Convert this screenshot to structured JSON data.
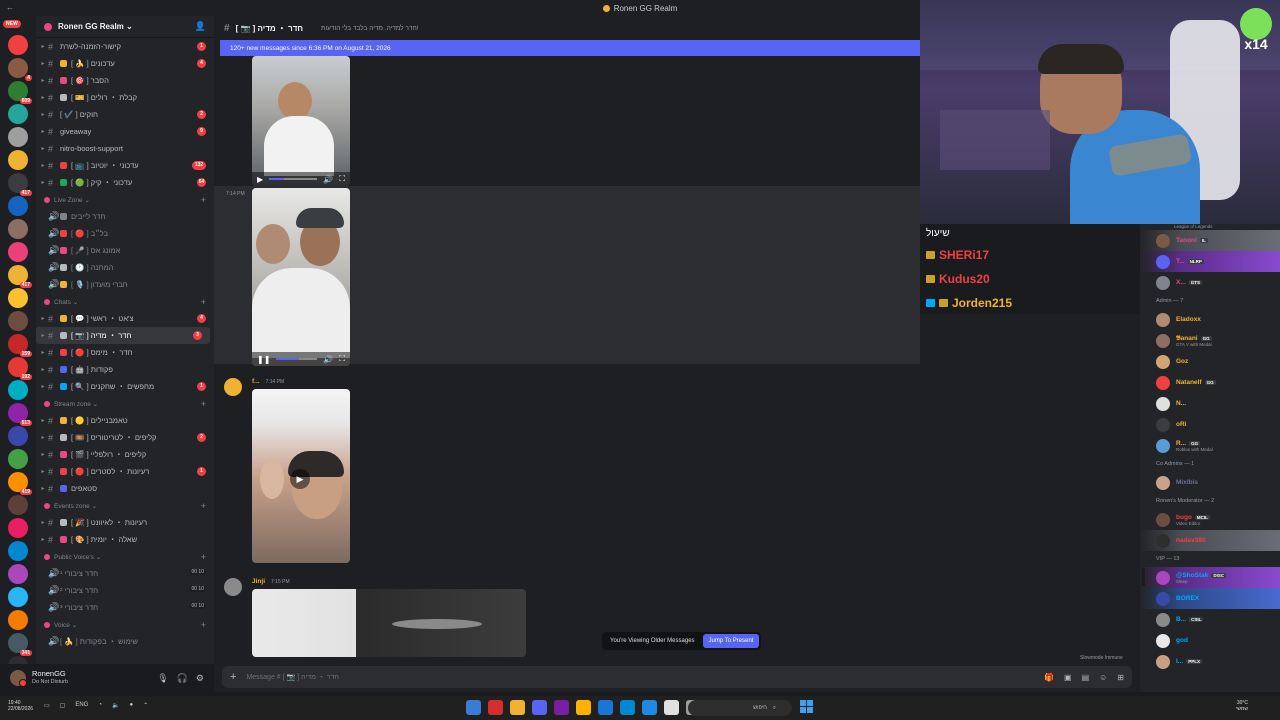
{
  "window": {
    "title": "Ronen GG Realm",
    "back_label": "←"
  },
  "rail": {
    "new_badge": "NEW",
    "guild_badges": [
      "",
      "4",
      "609",
      "",
      "",
      "",
      "417",
      "",
      "",
      "",
      "417",
      "",
      "",
      "159",
      "192",
      "",
      "513",
      "",
      "",
      "419",
      "",
      "",
      "",
      "",
      "",
      "",
      "341",
      "",
      "",
      ""
    ]
  },
  "server": {
    "name": "Ronen GG Realm ⌄"
  },
  "channels": [
    {
      "type": "text",
      "label": "קישור-הזמנה-לשרת",
      "count": "1",
      "emo": ""
    },
    {
      "type": "text",
      "label": "[ 🍌 ] עדכונים",
      "count": "4",
      "emo": "#f0b232"
    },
    {
      "type": "text",
      "label": "[ 🎯 ] הסבר",
      "count": "",
      "emo": "#e8497f"
    },
    {
      "type": "text",
      "label": "[ 🎫 ] קבלת ・ רולים",
      "count": "",
      "emo": "#b5bac1"
    },
    {
      "type": "text",
      "label": "[ ✔️ ] חוקים",
      "count": "2",
      "emo": ""
    },
    {
      "type": "text",
      "label": "giveaway",
      "count": "9",
      "emo": ""
    },
    {
      "type": "text",
      "label": "nitro-boost-support",
      "count": "",
      "emo": ""
    },
    {
      "type": "text",
      "label": "[ 📺 ] עדכוני ・ יוטיוב",
      "count": "132",
      "emo": "#f23f43"
    },
    {
      "type": "text",
      "label": "[ 🟢 ] עדכוני ・ קיק",
      "count": "64",
      "emo": "#23a55a"
    }
  ],
  "cat_live": {
    "label": "Live Zone ⌄",
    "plus": "+"
  },
  "live_channels": [
    {
      "label": "חדר לייבים",
      "emo": "#80848e"
    },
    {
      "label": "[ 🔴 ] בל״ב",
      "emo": "#f23f43"
    },
    {
      "label": "[ 🎤 ] אמונג אס",
      "emo": "#e8497f"
    },
    {
      "label": "[ 🕐 ] המתנה",
      "emo": "#b5bac1"
    },
    {
      "label": "[ 🎙️ ] חברי מועדון",
      "emo": "#f0b232"
    }
  ],
  "cat_chats": {
    "label": "Chats ⌄",
    "plus": "+"
  },
  "chat_channels": [
    {
      "label": "[ 💬 ] צ'אט ・ ראשי",
      "count": "4",
      "emo": "#f0b232",
      "active": false
    },
    {
      "label": "[ 📷 ] חדר ・ מדיה",
      "count": "3",
      "emo": "#b5bac1",
      "active": true
    },
    {
      "label": "[ 🔴 ] חדר ・ מימס",
      "count": "",
      "emo": "#f23f43",
      "active": false
    },
    {
      "label": "[ 🤖 ] פקודות",
      "count": "",
      "emo": "#5865f2",
      "active": false
    },
    {
      "label": "[ 🔍 ] מחפשים ・ שחקנים",
      "count": "1",
      "emo": "#00a8fc",
      "active": false
    }
  ],
  "cat_stream": {
    "label": "Stream zone ⌄",
    "plus": "+"
  },
  "stream_channels": [
    {
      "label": "[ 🟡 ] טאמבניילים",
      "count": "",
      "emo": "#f0b232"
    },
    {
      "label": "[ 🎞️ ] קליפים ・ לטריטוריס",
      "count": "2",
      "emo": "#b5bac1"
    },
    {
      "label": "[ 🎬 ] קליפים ・ רולפליי",
      "count": "",
      "emo": "#e8497f"
    },
    {
      "label": "[ 🔴 ] רעיונות ・ לסטרים",
      "count": "1",
      "emo": "#f23f43"
    },
    {
      "label": "סטאפים",
      "count": "",
      "emo": "#5865f2"
    }
  ],
  "cat_events": {
    "label": "Events zone ⌄",
    "plus": "+"
  },
  "event_channels": [
    {
      "label": "[ 🎉 ] רעיונות ・ לאיוונט",
      "count": "",
      "emo": "#b5bac1"
    },
    {
      "label": "[ 🎨 ] שאלה ・ יומית",
      "count": "",
      "emo": "#e8497f"
    }
  ],
  "cat_public": {
    "label": "Public Voice's ⌄",
    "plus": "+"
  },
  "public_voice": [
    {
      "label": "חדר ציבורי ¹",
      "num": "00 10"
    },
    {
      "label": "חדר ציבורי ²",
      "num": "00 10"
    },
    {
      "label": "חדר ציבורי ³",
      "num": "00 10"
    }
  ],
  "cat_voice": {
    "label": "Voice ⌄",
    "plus": "+"
  },
  "voice_channels": [
    {
      "label": "[ 🍌 ] שימוש ・ בפקודות"
    }
  ],
  "user": {
    "name": "RonenGG",
    "status": "Do Not Disturb"
  },
  "header": {
    "channel": "[ 📷 ] חדר ・ מדיה",
    "topic": "חדר למדיה. מדיה בלבד בלי הודעות!"
  },
  "new_messages": "120+ new messages since 6:36 PM on August 21, 2026",
  "messages": [
    {
      "time": "7:14 PM",
      "author": "",
      "kind": "video"
    },
    {
      "time": "7:14 PM",
      "author": "f...",
      "kind": "video"
    },
    {
      "time": "7:15 PM",
      "author": "Jinji",
      "kind": "video"
    }
  ],
  "video_icons": {
    "play": "▶",
    "pause": "❚❚",
    "volume": "🔊",
    "fullscreen": "⛶"
  },
  "older_notice": {
    "text": "You're Viewing Older Messages",
    "button": "Jump To Present"
  },
  "composer": {
    "placeholder": "Message # [ 📷 ] חדר ・ מדיה",
    "add": "+"
  },
  "slowmode": "Slowmode Immune",
  "stream_overlay": {
    "header": "שיעול",
    "chatters": [
      {
        "name": "SHERi17",
        "color": "#f23f43"
      },
      {
        "name": "Kudus20",
        "color": "#f23f43"
      },
      {
        "name": "Jorden215",
        "color": "#f0b232"
      }
    ],
    "badge": "x14"
  },
  "members": {
    "top_hint": "League of Legends",
    "groups": [
      {
        "title": "",
        "items": [
          {
            "name": "Tanoni",
            "tag": "IL",
            "sub": "",
            "color": "#e8497f",
            "hl": "hl"
          },
          {
            "name": "T...",
            "tag": "NLRP",
            "sub": "",
            "color": "#e8497f",
            "hl": "hl2"
          },
          {
            "name": "X...",
            "tag": "GTS",
            "sub": "",
            "color": "#e8497f",
            "hl": ""
          }
        ]
      },
      {
        "title": "Admin — 7",
        "items": [
          {
            "name": "Eladoxx",
            "tag": "",
            "sub": "",
            "color": "#f0b232",
            "hl": ""
          },
          {
            "name": "𝕭anani",
            "tag": "GG",
            "sub": "GTA V with Medal",
            "color": "#f0b232",
            "hl": ""
          },
          {
            "name": "Goz",
            "tag": "",
            "sub": "",
            "color": "#f0b232",
            "hl": ""
          },
          {
            "name": "Natanelf",
            "tag": "GG",
            "sub": "",
            "color": "#f0b232",
            "hl": ""
          },
          {
            "name": "N...",
            "tag": "",
            "sub": "",
            "color": "#f0b232",
            "hl": ""
          },
          {
            "name": "oRi",
            "tag": "",
            "sub": "",
            "color": "#f0b232",
            "hl": ""
          },
          {
            "name": "R...",
            "tag": "GG",
            "sub": "Roblox with Medal",
            "color": "#f0b232",
            "hl": ""
          }
        ]
      },
      {
        "title": "Co Admins — 1",
        "items": [
          {
            "name": "Mixlbis",
            "tag": "",
            "sub": "",
            "color": "#6d6f9a",
            "hl": ""
          }
        ]
      },
      {
        "title": "Ronen's Moderator — 2",
        "items": [
          {
            "name": "bugo",
            "tag": "MCIL",
            "sub": "Video Editor",
            "color": "#f23f43",
            "hl": ""
          },
          {
            "name": "nadav380",
            "tag": "",
            "sub": "",
            "color": "#f23f43",
            "hl": "hl"
          }
        ]
      },
      {
        "title": "VIP — 13",
        "items": [
          {
            "name": "@ShoStak",
            "tag": "DISC",
            "sub": "Sleep",
            "color": "#00a8fc",
            "hl": "hl2"
          },
          {
            "name": "BOREX",
            "tag": "",
            "sub": "",
            "color": "#00a8fc",
            "hl": "hl3"
          },
          {
            "name": "B...",
            "tag": "CSIL",
            "sub": "",
            "color": "#00a8fc",
            "hl": ""
          },
          {
            "name": "god",
            "tag": "",
            "sub": "",
            "color": "#00a8fc",
            "hl": ""
          },
          {
            "name": "I...",
            "tag": "PPLX",
            "sub": "",
            "color": "#00a8fc",
            "hl": ""
          }
        ]
      }
    ]
  },
  "taskbar": {
    "time": "19:40",
    "date": "22/08/2026",
    "lang": "ENG",
    "search": "חיפוש",
    "temp": "30°C",
    "weather": "שמשי"
  }
}
